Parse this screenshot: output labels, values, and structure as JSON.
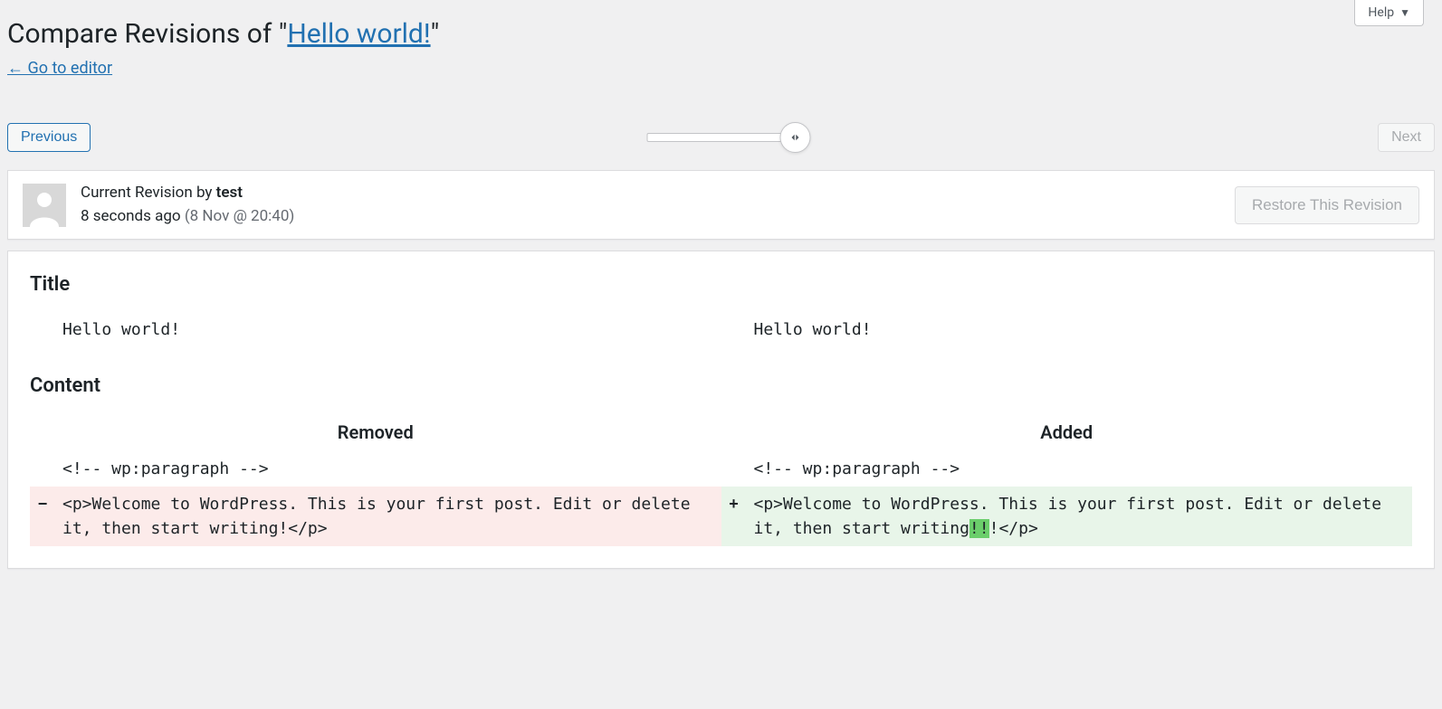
{
  "help": {
    "label": "Help"
  },
  "page": {
    "title_prefix": "Compare Revisions of \"",
    "title_link": "Hello world!",
    "title_suffix": "\"",
    "back_link": "← Go to editor"
  },
  "nav": {
    "previous": "Previous",
    "next": "Next"
  },
  "revision": {
    "header_prefix": "Current Revision by ",
    "author": "test",
    "time_ago": "8 seconds ago ",
    "date": "(8 Nov @ 20:40)",
    "restore_label": "Restore This Revision"
  },
  "diff": {
    "title_section": {
      "heading": "Title",
      "left": "Hello world!",
      "right": "Hello world!"
    },
    "content_section": {
      "heading": "Content",
      "removed_label": "Removed",
      "added_label": "Added",
      "context_line": "<!-- wp:paragraph -->",
      "removed_line": "<p>Welcome to WordPress. This is your first post. Edit or delete it, then start writing!</p>",
      "added_before": "<p>Welcome to WordPress. This is your first post. Edit or delete it, then start writing",
      "added_highlight": "!!",
      "added_after": "!</p>",
      "minus": "−",
      "plus": "+"
    }
  }
}
